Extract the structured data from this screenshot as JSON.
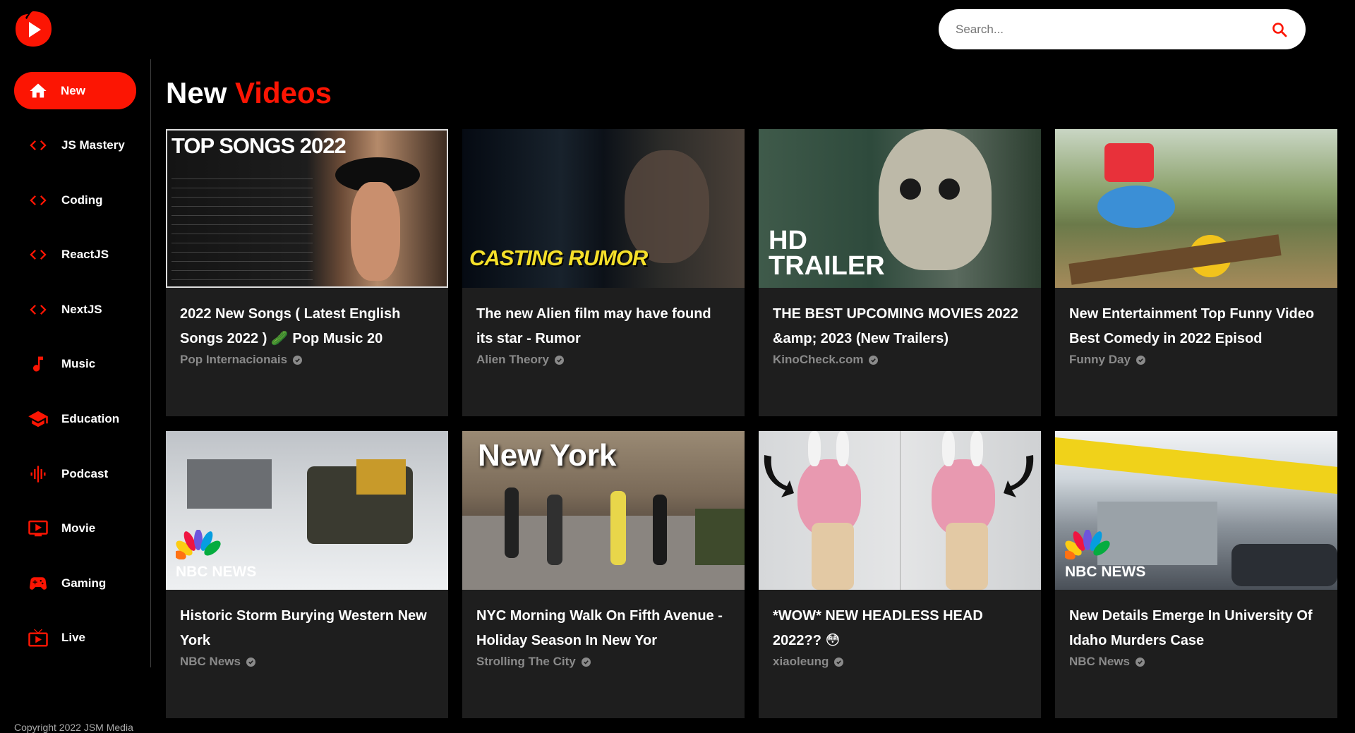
{
  "brand": {
    "logo_icon": "play-logo-icon",
    "accent": "#fc1503"
  },
  "search": {
    "placeholder": "Search...",
    "icon": "search-icon"
  },
  "sidebar": {
    "items": [
      {
        "label": "New",
        "icon": "home-icon",
        "active": true
      },
      {
        "label": "JS Mastery",
        "icon": "code-icon"
      },
      {
        "label": "Coding",
        "icon": "code-icon"
      },
      {
        "label": "ReactJS",
        "icon": "code-icon"
      },
      {
        "label": "NextJS",
        "icon": "code-icon"
      },
      {
        "label": "Music",
        "icon": "music-note-icon"
      },
      {
        "label": "Education",
        "icon": "school-icon"
      },
      {
        "label": "Podcast",
        "icon": "graphic-eq-icon"
      },
      {
        "label": "Movie",
        "icon": "ondemand-video-icon"
      },
      {
        "label": "Gaming",
        "icon": "gamepad-icon"
      },
      {
        "label": "Live",
        "icon": "live-tv-icon"
      }
    ],
    "copyright": "Copyright 2022 JSM Media"
  },
  "heading": {
    "text": "New",
    "accent": "Videos"
  },
  "videos": [
    {
      "title": "2022 New Songs ( Latest English Songs 2022 ) 🥒 Pop Music 20",
      "channel": "Pop Internacionais",
      "thumb_text": "TOP SONGS 2022"
    },
    {
      "title": "The new Alien film may have found its star - Rumor",
      "channel": "Alien Theory",
      "thumb_text": "CASTING RUMOR"
    },
    {
      "title": "THE BEST UPCOMING MOVIES 2022 &amp; 2023 (New Trailers)",
      "channel": "KinoCheck.com",
      "thumb_text": "HD TRAILER"
    },
    {
      "title": "New Entertainment Top Funny Video Best Comedy in 2022 Episod",
      "channel": "Funny Day",
      "thumb_text": ""
    },
    {
      "title": "Historic Storm Burying Western New York",
      "channel": "NBC News",
      "thumb_text": "NBC NEWS"
    },
    {
      "title": "NYC Morning Walk On Fifth Avenue - Holiday Season In New Yor",
      "channel": "Strolling The City",
      "thumb_text": "New York"
    },
    {
      "title": "*WOW* NEW HEADLESS HEAD 2022?? 😳",
      "channel": "xiaoleung",
      "thumb_text": ""
    },
    {
      "title": "New Details Emerge In University Of Idaho Murders Case",
      "channel": "NBC News",
      "thumb_text": "NBC NEWS"
    }
  ]
}
